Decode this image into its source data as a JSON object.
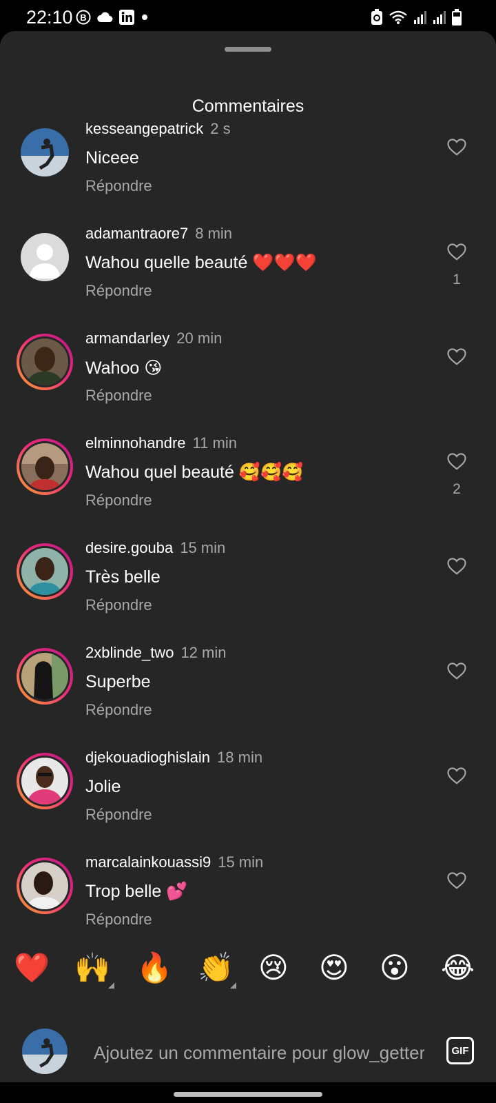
{
  "status_bar": {
    "time": "22:10",
    "left_icons": [
      "b-badge-icon",
      "cloud-icon",
      "linkedin-icon",
      "dot-icon"
    ],
    "right_icons": [
      "recycle-icon",
      "wifi-icon",
      "signal-icon",
      "signal-icon",
      "battery-icon"
    ]
  },
  "sheet": {
    "title": "Commentaires"
  },
  "comments": [
    {
      "username": "kesseangepatrick",
      "time": "2 s",
      "text": "Niceee",
      "reply": "Répondre",
      "likes": "",
      "story_ring": false,
      "avatar": "photo"
    },
    {
      "username": "adamantraore7",
      "time": "8 min",
      "text": "Wahou quelle beauté ❤️❤️❤️",
      "reply": "Répondre",
      "likes": "1",
      "story_ring": false,
      "avatar": "default"
    },
    {
      "username": "armandarley",
      "time": "20 min",
      "text": "Wahoo 😘",
      "reply": "Répondre",
      "likes": "",
      "story_ring": true,
      "avatar": "photo"
    },
    {
      "username": "elminnohandre",
      "time": "11 min",
      "text": "Wahou quel beauté 🥰🥰🥰",
      "reply": "Répondre",
      "likes": "2",
      "story_ring": true,
      "avatar": "photo"
    },
    {
      "username": "desire.gouba",
      "time": "15 min",
      "text": "Très belle",
      "reply": "Répondre",
      "likes": "",
      "story_ring": true,
      "avatar": "photo"
    },
    {
      "username": "2xblinde_two",
      "time": "12 min",
      "text": "Superbe",
      "reply": "Répondre",
      "likes": "",
      "story_ring": true,
      "avatar": "photo"
    },
    {
      "username": "djekouadioghislain",
      "time": "18 min",
      "text": "Jolie",
      "reply": "Répondre",
      "likes": "",
      "story_ring": true,
      "avatar": "photo"
    },
    {
      "username": "marcalainkouassi9",
      "time": "15 min",
      "text": "Trop belle 💕",
      "reply": "Répondre",
      "likes": "",
      "story_ring": true,
      "avatar": "photo"
    }
  ],
  "reactions": [
    "❤️",
    "🙌",
    "🔥",
    "👏",
    "😢",
    "😍",
    "😮",
    "😂"
  ],
  "composer": {
    "placeholder": "Ajoutez un commentaire pour glow_getter",
    "gif_label": "GIF"
  },
  "colors": {
    "sheet_bg": "#262626",
    "secondary_text": "#a8a8a8",
    "story_ring_start": "#f9a52e",
    "story_ring_end": "#bc1888"
  }
}
